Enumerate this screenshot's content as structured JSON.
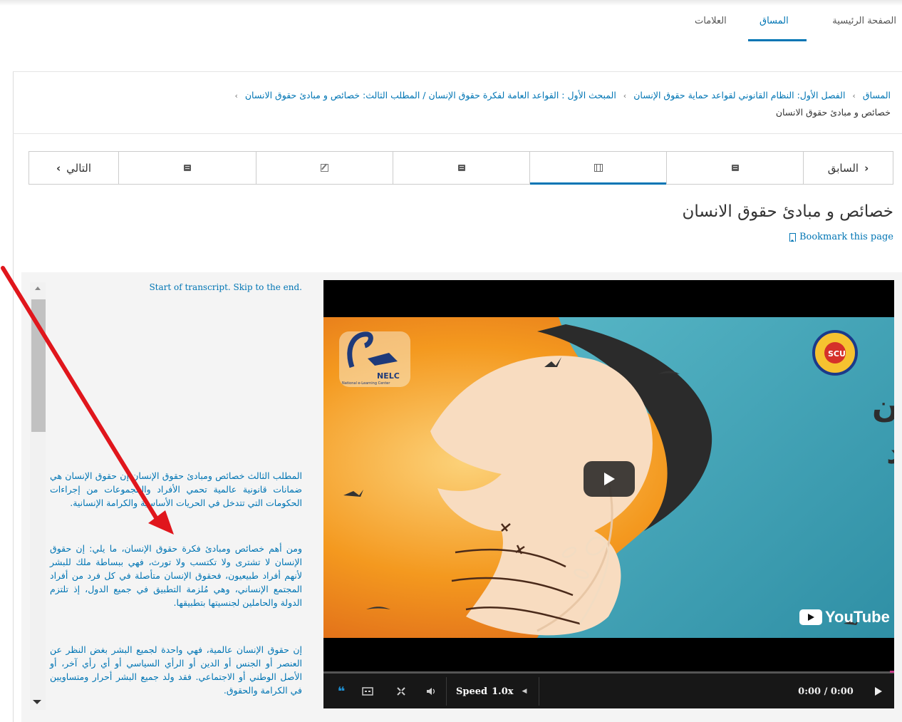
{
  "tabs": [
    {
      "label": "الصفحة الرئيسية"
    },
    {
      "label": "المساق"
    },
    {
      "label": "العلامات"
    }
  ],
  "breadcrumb": {
    "items": [
      "المساق",
      "الفصل الأول: النظام القانوني لقواعد حماية حقوق الإنسان",
      "المبحث الأول : القواعد العامة لفكرة حقوق الإنسان / المطلب الثالث: خصائص و مبادئ حقوق الانسان"
    ],
    "current": "خصائص و مبادئ حقوق الانسان"
  },
  "sequence_nav": {
    "prev_label": "السابق",
    "next_label": "التالي",
    "prev_arrow": "‹",
    "next_arrow": "›",
    "units": [
      {
        "icon": "book-icon"
      },
      {
        "icon": "video-icon",
        "active": true
      },
      {
        "icon": "book-icon"
      },
      {
        "icon": "edit-icon"
      },
      {
        "icon": "book-icon"
      }
    ]
  },
  "unit": {
    "title": "خصائص و مبادئ حقوق الانسان",
    "bookmark_label": "Bookmark this page"
  },
  "transcript": {
    "start_link": "Start of transcript. Skip to the end.",
    "paragraphs": [
      "المطلب الثالث خصائص ومبادئ حقوق الإنسان إن حقوق الإنسان هي ضمانات قانونية عالمية تحمي الأفراد والمجموعات من إجراءات الحكومات التي تتدخل في الحريات الأساسية والكرامة الإنسانية.",
      "ومن أهم خصائص ومبادئ فكرة حقوق الإنسان، ما يلي: إن حقوق الإنسان لا تشترى ولا تكتسب ولا تورث، فهي ببساطة ملك للبشر لأنهم أفراد طبيعيون، فحقوق الإنسان متأصلة في كل فرد من أفراد المجتمع الإنساني، وهي مُلزمة التطبيق في جميع الدول، إذ تلتزم الدولة والحاملين لجنسيتها بتطبيقها.",
      "إن حقوق الإنسان عالمية، فهي واحدة لجميع البشر بغض النظر عن العنصر أو الجنس أو الدين أو الرأي السياسي أو أي رأي آخر، أو الأصل الوطني أو الاجتماعي. فقد ولد جميع البشر أحرار ومتساويين في الكرامة والحقوق."
    ]
  },
  "video": {
    "title_line1": "حقوق الإنسان",
    "title_line2": "ومكافحة الفساد",
    "logo_left_text": "NELC",
    "logo_left_sub": "National e-Learning Center",
    "logo_right_text": "SCU",
    "youtube_label": "YouTube",
    "speed_label": "Speed",
    "speed_value": "1.0x",
    "time": "0:00 / 0:00",
    "colors": {
      "orange": "#f18a1c",
      "teal": "#3d9fb3",
      "cream": "#f8dcc0",
      "dark": "#2d2d2d"
    }
  },
  "colors": {
    "link": "#0075b4",
    "annotation": "#e0161c"
  }
}
